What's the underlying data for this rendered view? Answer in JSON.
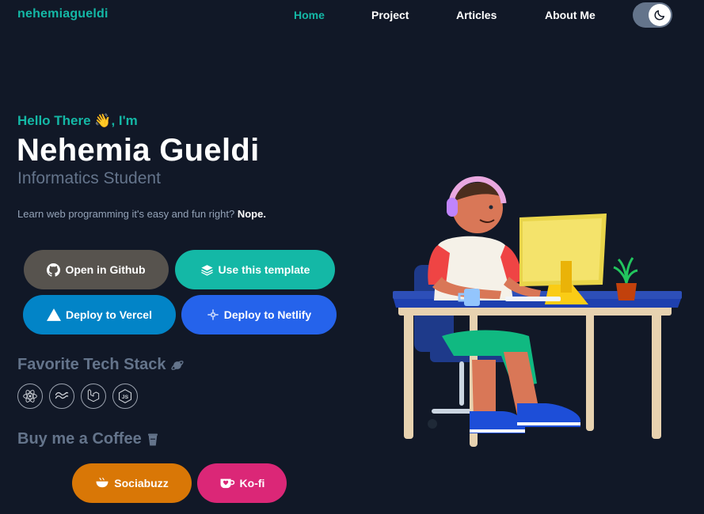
{
  "nav": {
    "brand": "nehemiagueldi",
    "links": [
      {
        "label": "Home",
        "active": true
      },
      {
        "label": "Project",
        "active": false
      },
      {
        "label": "Articles",
        "active": false
      },
      {
        "label": "About Me",
        "active": false
      }
    ],
    "theme_toggle_icon": "moon-icon"
  },
  "hero": {
    "greeting": "Hello There 👋, I'm",
    "name": "Nehemia Gueldi",
    "role": "Informatics Student",
    "tagline": "Learn web programming it's easy and fun right?",
    "tagline_emphasis": "Nope."
  },
  "buttons": {
    "github": "Open in Github",
    "template": "Use this template",
    "vercel": "Deploy to Vercel",
    "netlify": "Deploy to Netlify"
  },
  "tech_stack": {
    "title": "Favorite Tech Stack",
    "title_icon": "planet-icon",
    "icons": [
      "react-icon",
      "tailwind-icon",
      "laravel-icon",
      "nodejs-icon"
    ]
  },
  "coffee": {
    "title": "Buy me a Coffee",
    "title_icon": "coffee-cup-icon",
    "sociabuzz": "Sociabuzz",
    "kofi": "Ko-fi"
  },
  "colors": {
    "accent": "#14b8a6",
    "background": "#111827",
    "muted": "#64748b",
    "github_btn": "#57534e",
    "template_btn": "#14b8a6",
    "vercel_btn": "#0284c7",
    "netlify_btn": "#2563eb",
    "sociabuzz_btn": "#d97706",
    "kofi_btn": "#db2777"
  }
}
